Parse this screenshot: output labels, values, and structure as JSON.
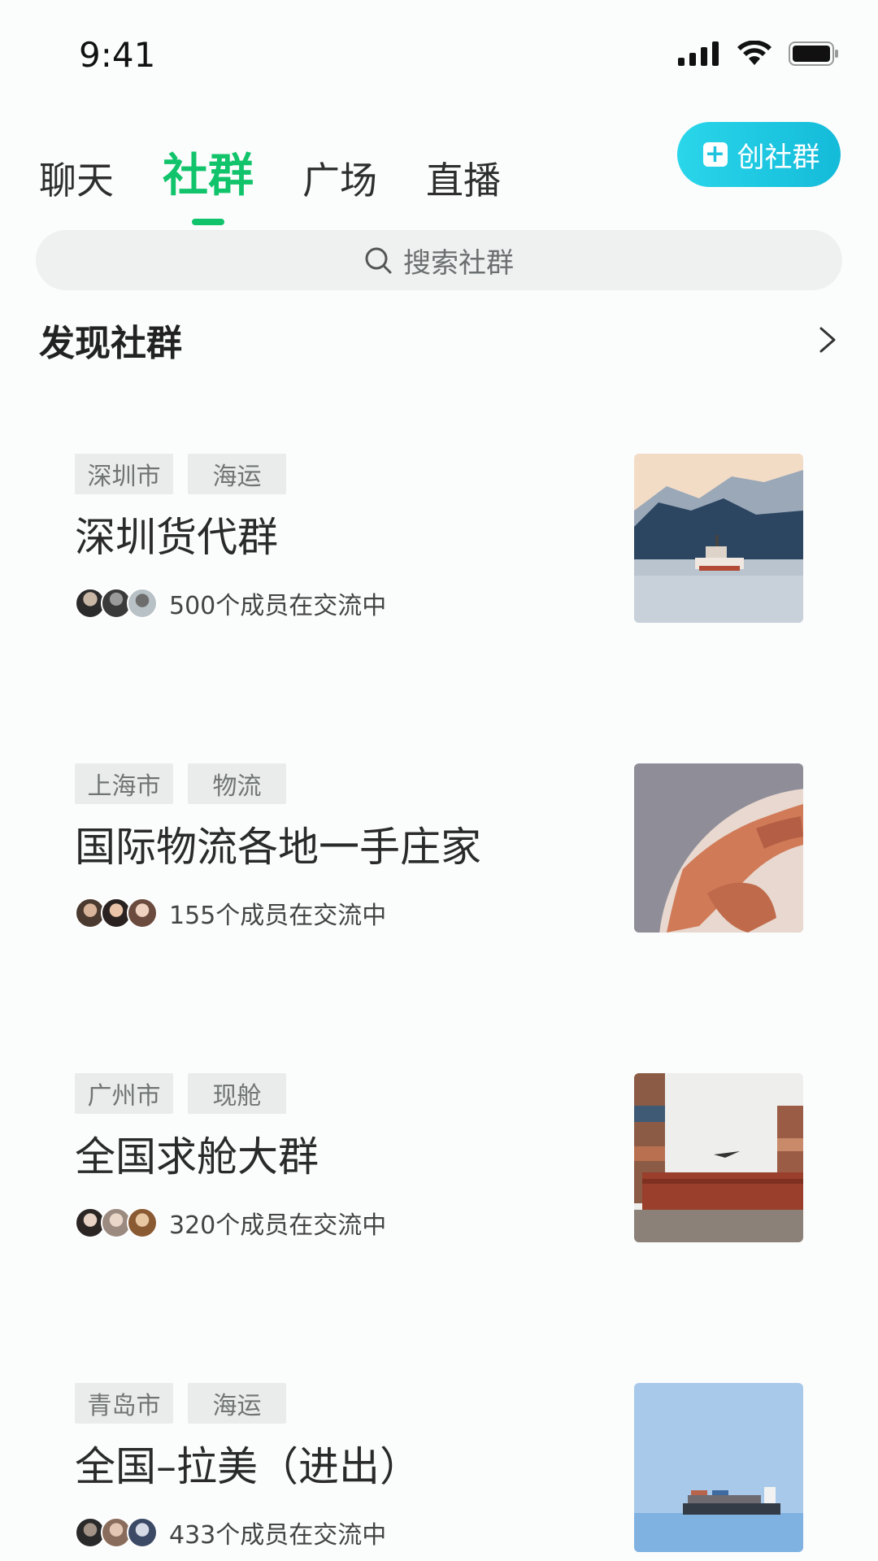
{
  "status_bar": {
    "time": "9:41"
  },
  "tabs": [
    {
      "label": "聊天",
      "active": false
    },
    {
      "label": "社群",
      "active": true
    },
    {
      "label": "广场",
      "active": false
    },
    {
      "label": "直播",
      "active": false
    }
  ],
  "create_button": {
    "label": "创社群",
    "icon": "plus-square-icon"
  },
  "search": {
    "placeholder": "搜索社群",
    "icon": "search-icon"
  },
  "section": {
    "title": "发现社群",
    "icon": "chevron-right-icon"
  },
  "groups": [
    {
      "tags": [
        "深圳市",
        "海运"
      ],
      "name": "深圳货代群",
      "members": "500个成员在交流中",
      "image": "ship-at-sea-photo"
    },
    {
      "tags": [
        "上海市",
        "物流"
      ],
      "name": "国际物流各地一手庄家",
      "members": "155个成员在交流中",
      "image": "globe-photo"
    },
    {
      "tags": [
        "广州市",
        "现舱"
      ],
      "name": "全国求舱大群",
      "members": "320个成员在交流中",
      "image": "containers-photo"
    },
    {
      "tags": [
        "青岛市",
        "海运"
      ],
      "name": "全国–拉美（进出）",
      "members": "433个成员在交流中",
      "image": "container-ship-photo"
    }
  ],
  "colors": {
    "accent": "#11c46b",
    "create_button": "#1ec3de",
    "search_bg": "#eef1ef",
    "tag_bg": "#e9ecea"
  }
}
